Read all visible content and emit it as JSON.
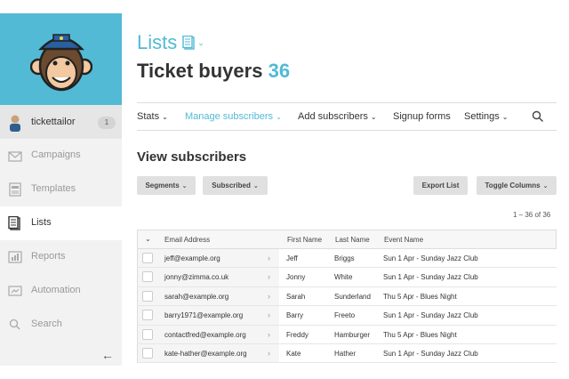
{
  "sidebar": {
    "user": {
      "name": "tickettailor",
      "count": "1"
    },
    "items": [
      {
        "label": "Campaigns",
        "icon": "envelope-icon"
      },
      {
        "label": "Templates",
        "icon": "template-icon"
      },
      {
        "label": "Lists",
        "icon": "list-icon"
      },
      {
        "label": "Reports",
        "icon": "bar-chart-icon"
      },
      {
        "label": "Automation",
        "icon": "automation-icon"
      },
      {
        "label": "Search",
        "icon": "search-icon"
      }
    ],
    "collapse": "←"
  },
  "header": {
    "section": "Lists",
    "list_name": "Ticket buyers",
    "list_count": "36"
  },
  "tabs": [
    {
      "label": "Stats",
      "dropdown": "⌄"
    },
    {
      "label": "Manage subscribers",
      "dropdown": "⌄"
    },
    {
      "label": "Add subscribers",
      "dropdown": "⌄"
    },
    {
      "label": "Signup forms",
      "dropdown": ""
    },
    {
      "label": "Settings",
      "dropdown": "⌄"
    }
  ],
  "view": {
    "title": "View subscribers",
    "buttons": {
      "segments": "Segments",
      "subscribed": "Subscribed",
      "export": "Export List",
      "toggle": "Toggle Columns"
    },
    "range": "1 – 36 of 36"
  },
  "table": {
    "headers": {
      "email": "Email Address",
      "first": "First Name",
      "last": "Last Name",
      "event": "Event Name"
    },
    "rows": [
      {
        "email": "jeff@example.org",
        "first": "Jeff",
        "last": "Briggs",
        "event": "Sun 1 Apr - Sunday Jazz Club"
      },
      {
        "email": "jonny@zimma.co.uk",
        "first": "Jonny",
        "last": "White",
        "event": "Sun 1 Apr - Sunday Jazz Club"
      },
      {
        "email": "sarah@example.org",
        "first": "Sarah",
        "last": "Sunderland",
        "event": "Thu 5 Apr - Blues Night"
      },
      {
        "email": "barry1971@example.org",
        "first": "Barry",
        "last": "Freeto",
        "event": "Sun 1 Apr - Sunday Jazz Club"
      },
      {
        "email": "contactfred@example.org",
        "first": "Freddy",
        "last": "Hamburger",
        "event": "Thu 5 Apr - Blues Night"
      },
      {
        "email": "kate-hather@example.org",
        "first": "Kate",
        "last": "Hather",
        "event": "Sun 1 Apr - Sunday Jazz Club"
      }
    ]
  },
  "colors": {
    "accent": "#52bad5",
    "sidebar_bg": "#f2f2f2"
  }
}
